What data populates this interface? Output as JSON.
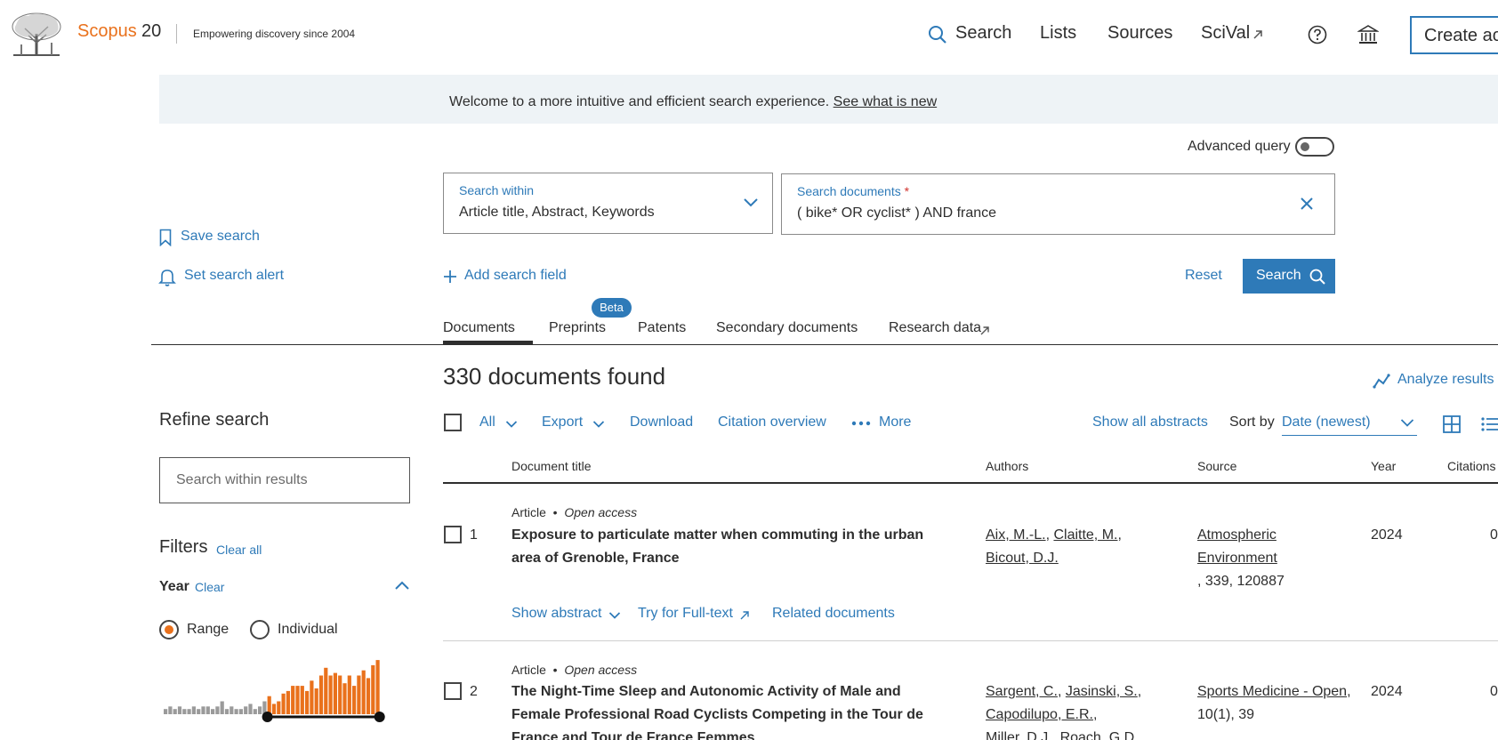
{
  "header": {
    "brand": "Scopus",
    "brand_number": "20",
    "tagline": "Empowering discovery since 2004",
    "nav": [
      {
        "label": "Search",
        "icon": "search-icon"
      },
      {
        "label": "Lists"
      },
      {
        "label": "Sources"
      },
      {
        "label": "SciVal",
        "icon": "external-link-icon"
      }
    ],
    "help_icon": "help-circle-icon",
    "institution_icon": "institution-icon",
    "create_account": "Create ac"
  },
  "banner": {
    "text": "Welcome to a more intuitive and efficient search experience.",
    "link": "See what is new"
  },
  "advanced_query": {
    "label": "Advanced query",
    "enabled": false
  },
  "search": {
    "within_label": "Search within",
    "within_value": "Article title, Abstract, Keywords",
    "documents_label": "Search documents",
    "required_mark": "*",
    "query": "( bike* OR cyclist* ) AND france",
    "add_field": "Add search field",
    "reset": "Reset",
    "search_button": "Search"
  },
  "side_actions": {
    "save_search": "Save search",
    "set_alert": "Set search alert"
  },
  "tabs": [
    {
      "label": "Documents",
      "active": true
    },
    {
      "label": "Preprints",
      "badge": "Beta"
    },
    {
      "label": "Patents"
    },
    {
      "label": "Secondary documents"
    },
    {
      "label": "Research data",
      "icon": "external-link-icon"
    }
  ],
  "results": {
    "count_text": "330 documents found",
    "analyze": "Analyze results"
  },
  "refine": {
    "title": "Refine search",
    "within_placeholder": "Search within results",
    "filters_title": "Filters",
    "clear_all": "Clear all",
    "year_title": "Year",
    "year_clear": "Clear",
    "range_label": "Range",
    "individual_label": "Individual",
    "year_mode": "Range",
    "histogram_grey": [
      2,
      3,
      2,
      3,
      2,
      2,
      3,
      2,
      3,
      3,
      2,
      3,
      5,
      2,
      3,
      2,
      2,
      3,
      4,
      2,
      3,
      5
    ],
    "histogram_orange": [
      7,
      4,
      5,
      8,
      9,
      11,
      11,
      11,
      9,
      13,
      10,
      15,
      18,
      15,
      16,
      15,
      12,
      15,
      11,
      15,
      17,
      14,
      19,
      21
    ],
    "histogram_colors": {
      "grey": "#9a9a9a",
      "orange": "#e9711c"
    }
  },
  "toolbar": {
    "all": "All",
    "export": "Export",
    "download": "Download",
    "citation_overview": "Citation overview",
    "more": "More",
    "show_all_abstracts": "Show all abstracts",
    "sort_by": "Sort by",
    "sort_value": "Date (newest)"
  },
  "table": {
    "headers": {
      "title": "Document title",
      "authors": "Authors",
      "source": "Source",
      "year": "Year",
      "citations": "Citations"
    },
    "rows": [
      {
        "num": "1",
        "type": "Article",
        "access": "Open access",
        "title": "Exposure to particulate matter when commuting in the urban area of Grenoble, France",
        "authors": [
          "Aix, M.-L.",
          "Claitte, M.",
          "Bicout, D.J."
        ],
        "source": "Atmospheric Environment",
        "source_detail": ", 339, 120887",
        "year": "2024",
        "citations": "0",
        "actions": {
          "show_abstract": "Show abstract",
          "full_text": "Try for Full-text",
          "related": "Related documents"
        }
      },
      {
        "num": "2",
        "type": "Article",
        "access": "Open access",
        "title": "The Night-Time Sleep and Autonomic Activity of Male and Female Professional Road Cyclists Competing in the Tour de France and Tour de France Femmes",
        "authors": [
          "Sargent, C.",
          "Jasinski, S.",
          "Capodilupo, E.R.",
          "Miller, D.J.",
          "Roach, G.D."
        ],
        "source": "Sports Medicine - Open",
        "source_detail": "10(1), 39",
        "year": "2024",
        "citations": "0"
      }
    ]
  },
  "colors": {
    "accent": "#2e7ab8",
    "brand_orange": "#e9711c",
    "banner_bg": "#eef3f6"
  }
}
